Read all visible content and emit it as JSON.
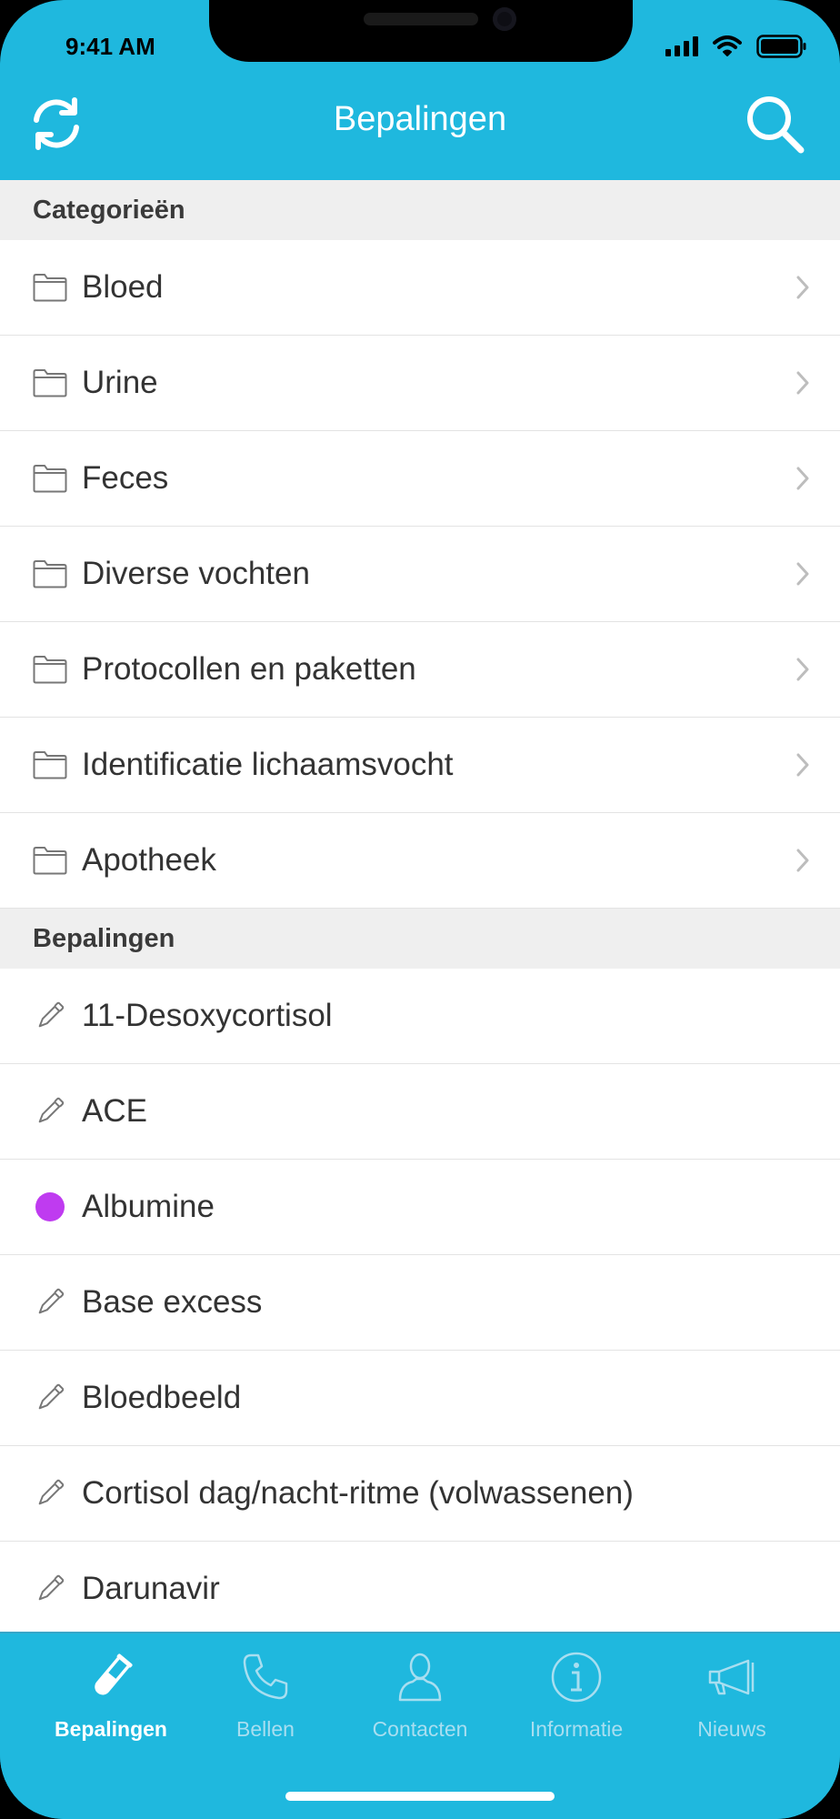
{
  "status_bar": {
    "time": "9:41 AM"
  },
  "header": {
    "title": "Bepalingen"
  },
  "sections": {
    "categories": {
      "title": "Categorieën",
      "items": [
        "Bloed",
        "Urine",
        "Feces",
        "Diverse vochten",
        "Protocollen en paketten",
        "Identificatie lichaamsvocht",
        "Apotheek"
      ]
    },
    "determinations": {
      "title": "Bepalingen",
      "items": [
        "11-Desoxycortisol",
        "ACE",
        "Albumine",
        "Base excess",
        "Bloedbeeld",
        "Cortisol dag/nacht-ritme (volwassenen)",
        "Darunavir"
      ]
    }
  },
  "tabbar": {
    "tabs": [
      {
        "label": "Bepalingen",
        "icon": "test-tube-icon",
        "active": true
      },
      {
        "label": "Bellen",
        "icon": "phone-icon",
        "active": false
      },
      {
        "label": "Contacten",
        "icon": "person-icon",
        "active": false
      },
      {
        "label": "Informatie",
        "icon": "info-icon",
        "active": false
      },
      {
        "label": "Nieuws",
        "icon": "megaphone-icon",
        "active": false
      }
    ]
  },
  "colors": {
    "accent": "#1fb8de",
    "dot": "#bf3bf0",
    "tab_inactive": "#a8def0"
  },
  "icons": {
    "category": "folder-icon",
    "determination": "pipette-icon",
    "albumine": "purple-dot-icon",
    "row_chevron": "chevron-right-icon"
  }
}
